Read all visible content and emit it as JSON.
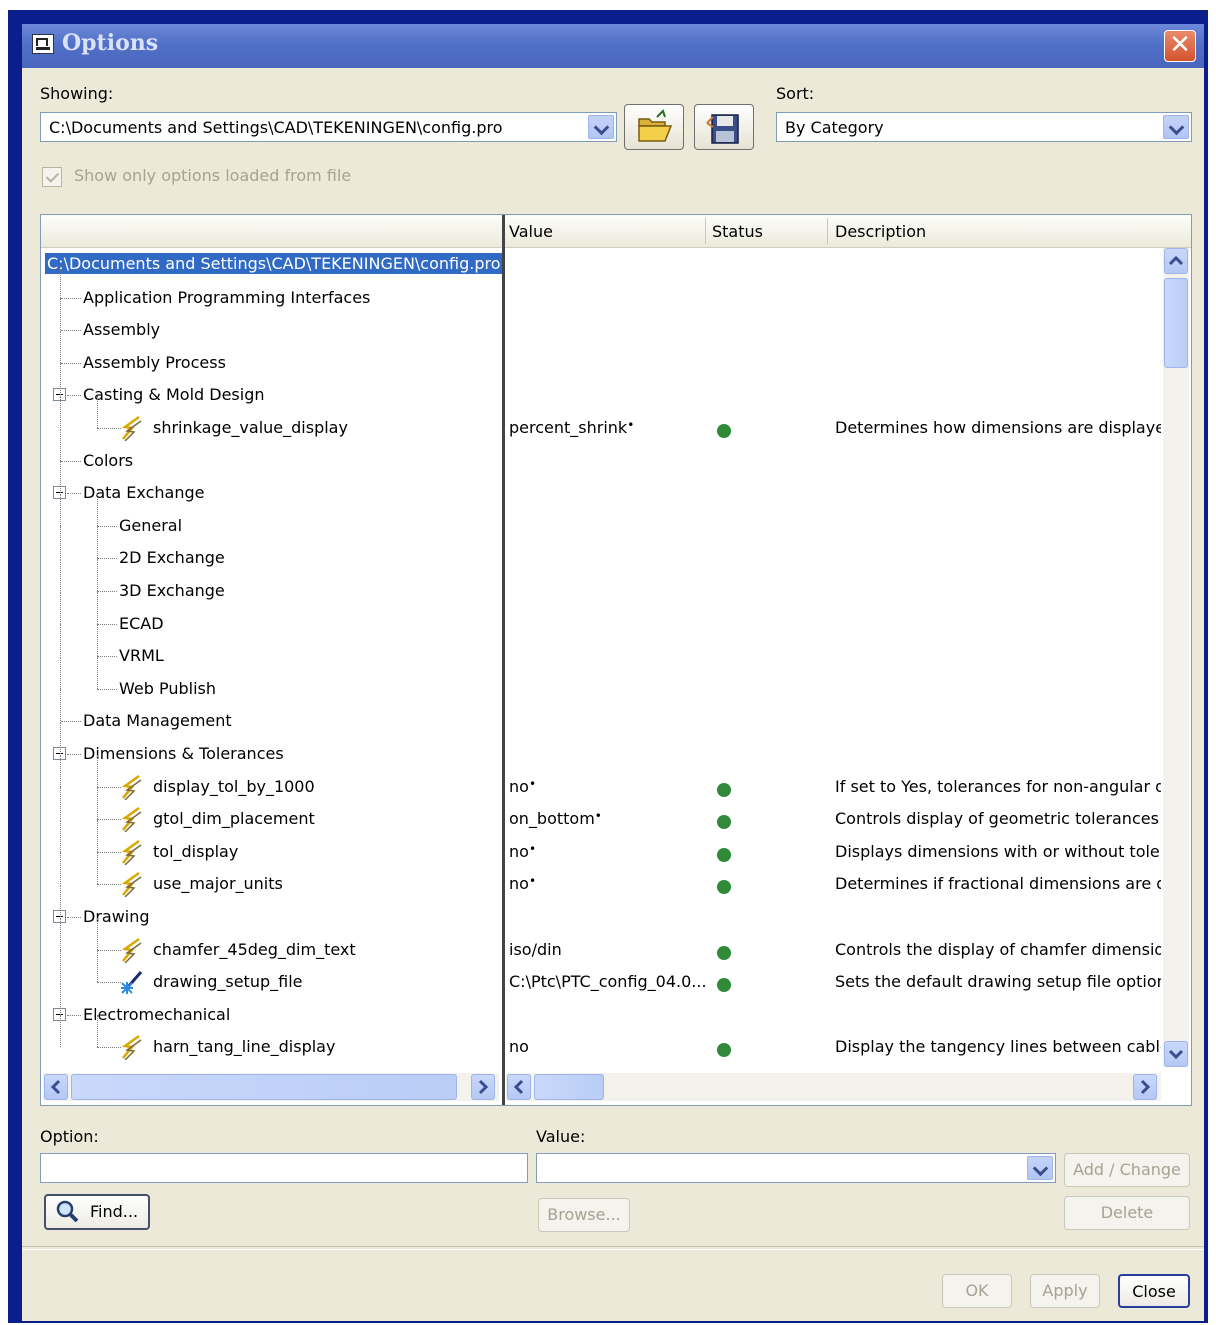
{
  "window": {
    "title": "Options"
  },
  "showing": {
    "label": "Showing:",
    "value": "C:\\Documents and Settings\\CAD\\TEKENINGEN\\config.pro"
  },
  "sort": {
    "label": "Sort:",
    "value": "By Category"
  },
  "show_only_loaded": {
    "label": "Show only options loaded from file",
    "checked": true,
    "enabled": false
  },
  "columns": {
    "value": "Value",
    "status": "Status",
    "description": "Description"
  },
  "tree": {
    "root": "C:\\Documents and Settings\\CAD\\TEKENINGEN\\config.pro",
    "rows": [
      {
        "label": "Application Programming Interfaces"
      },
      {
        "label": "Assembly"
      },
      {
        "label": "Assembly Process"
      },
      {
        "label": "Casting & Mold Design",
        "expanded": true
      },
      {
        "label": "shrinkage_value_display",
        "option": true,
        "value": "percent_shrink",
        "value_marker": "•",
        "status": "green",
        "description": "Determines how dimensions are displayed w"
      },
      {
        "label": "Colors"
      },
      {
        "label": "Data Exchange",
        "expanded": true
      },
      {
        "label": "General"
      },
      {
        "label": "2D Exchange"
      },
      {
        "label": "3D Exchange"
      },
      {
        "label": "ECAD"
      },
      {
        "label": "VRML"
      },
      {
        "label": "Web Publish"
      },
      {
        "label": "Data Management"
      },
      {
        "label": "Dimensions & Tolerances",
        "expanded": true
      },
      {
        "label": "display_tol_by_1000",
        "option": true,
        "value": "no",
        "value_marker": "•",
        "status": "green",
        "description": "If set to Yes, tolerances for non-angular dim"
      },
      {
        "label": "gtol_dim_placement",
        "option": true,
        "value": "on_bottom",
        "value_marker": "•",
        "status": "green",
        "description": "Controls display of geometric tolerances in"
      },
      {
        "label": "tol_display",
        "option": true,
        "value": "no",
        "value_marker": "•",
        "status": "green",
        "description": "Displays dimensions with or without toleranc"
      },
      {
        "label": "use_major_units",
        "option": true,
        "value": "no",
        "value_marker": "•",
        "status": "green",
        "description": "Determines if fractional dimensions are disp"
      },
      {
        "label": "Drawing",
        "expanded": true
      },
      {
        "label": "chamfer_45deg_dim_text",
        "option": true,
        "value": "iso/din",
        "status": "green",
        "description": "Controls the display of chamfer dimension t"
      },
      {
        "label": "drawing_setup_file",
        "option": true,
        "value": "C:\\Ptc\\PTC_config_04.0...",
        "status": "green",
        "description": "Sets the default drawing setup file option val"
      },
      {
        "label": "Electromechanical",
        "expanded": true
      },
      {
        "label": "harn_tang_line_display",
        "option": true,
        "value": "no",
        "status": "green",
        "description": "Display the tangency lines between cable seg"
      }
    ]
  },
  "option_field": {
    "label": "Option:",
    "value": ""
  },
  "value_field": {
    "label": "Value:",
    "value": ""
  },
  "buttons": {
    "find": "Find...",
    "browse": "Browse...",
    "add_change": "Add / Change",
    "delete": "Delete",
    "ok": "OK",
    "apply": "Apply",
    "close": "Close"
  },
  "colors": {
    "title_bar": "#5170c8",
    "selection": "#316ac5",
    "status_ok": "#2f8a3a",
    "dialog_bg": "#ece9d8"
  }
}
